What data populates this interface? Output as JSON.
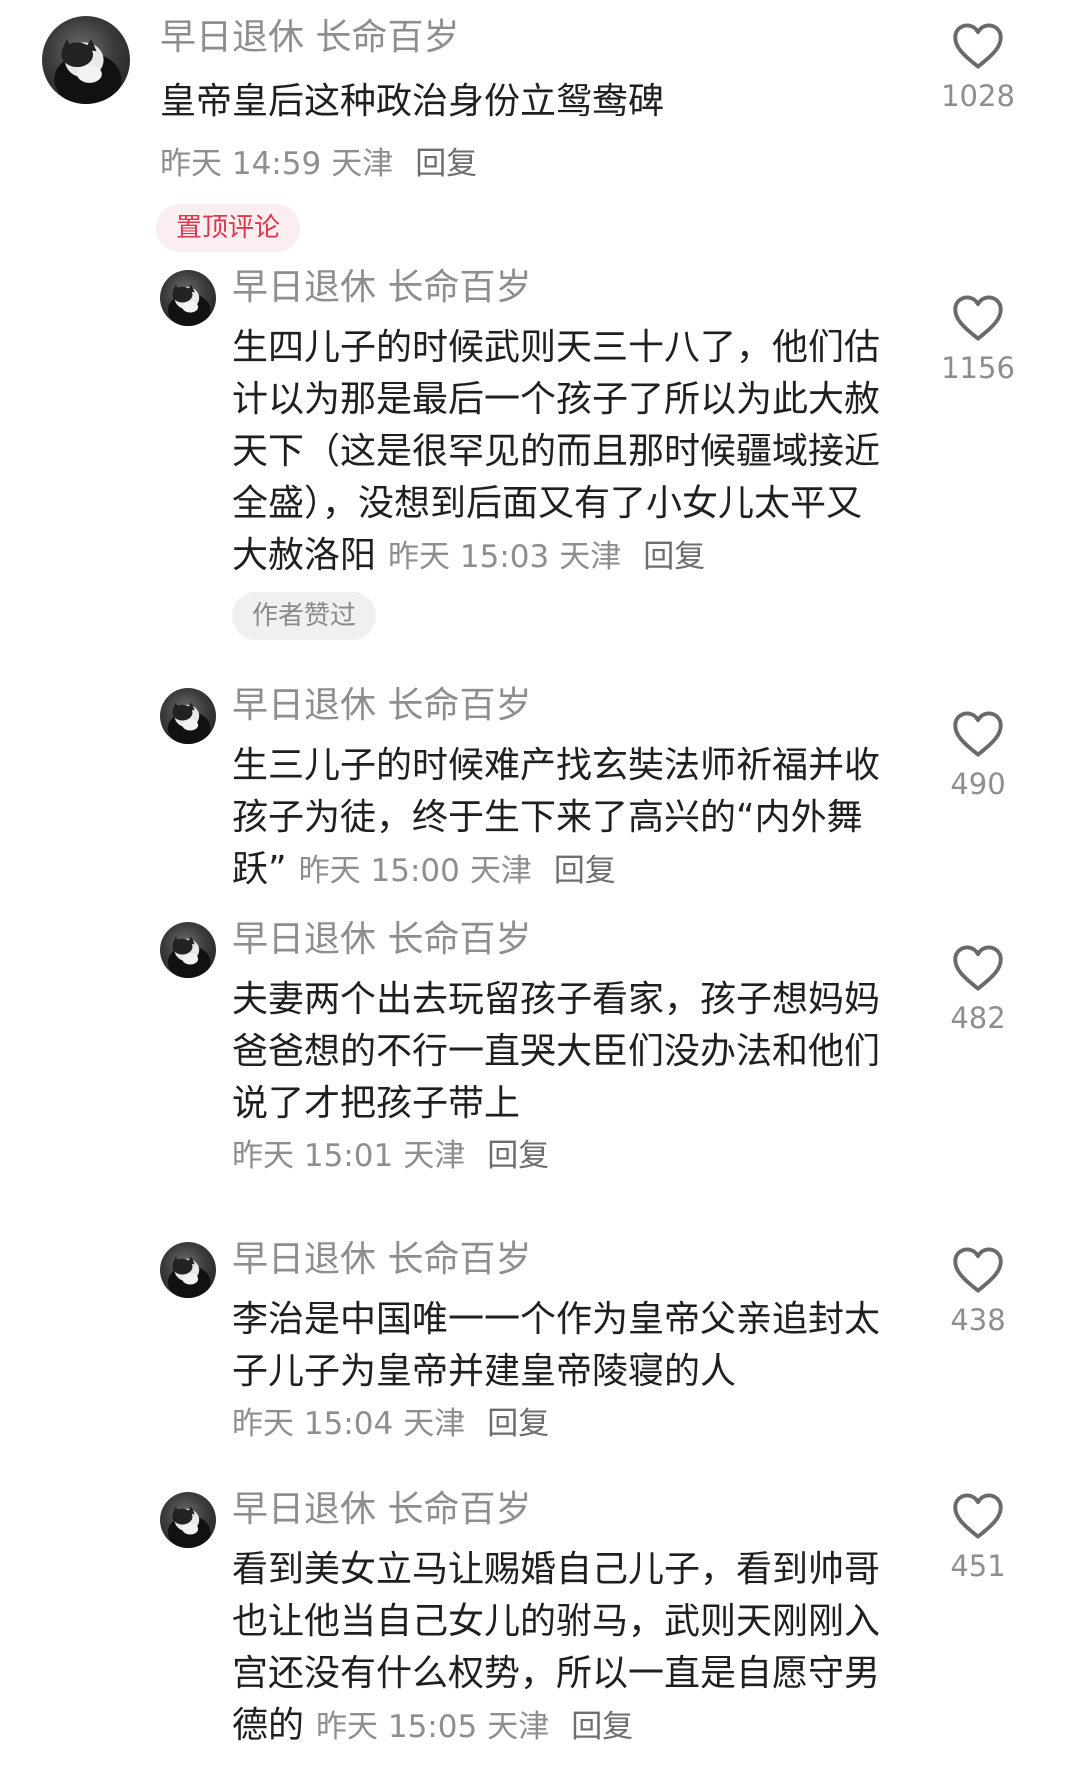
{
  "comments": [
    {
      "username": "早日退休 长命百岁",
      "text": "皇帝皇后这种政治身份立鸳鸯碑",
      "time": "昨天 14:59",
      "location": "天津",
      "reply_label": "回复",
      "likes": "1028",
      "badge": "置顶评论"
    },
    {
      "username": "早日退休 长命百岁",
      "text": "生四儿子的时候武则天三十八了，他们估计以为那是最后一个孩子了所以为此大赦天下（这是很罕见的而且那时候疆域接近全盛），没想到后面又有了小女儿太平又大赦洛阳",
      "time": "昨天 15:03",
      "location": "天津",
      "reply_label": "回复",
      "likes": "1156",
      "badge": "作者赞过"
    },
    {
      "username": "早日退休 长命百岁",
      "text": "生三儿子的时候难产找玄奘法师祈福并收孩子为徒，终于生下来了高兴的“内外舞跃”",
      "time": "昨天 15:00",
      "location": "天津",
      "reply_label": "回复",
      "likes": "490"
    },
    {
      "username": "早日退休 长命百岁",
      "text": "夫妻两个出去玩留孩子看家，孩子想妈妈爸爸想的不行一直哭大臣们没办法和他们说了才把孩子带上",
      "time": "昨天 15:01",
      "location": "天津",
      "reply_label": "回复",
      "likes": "482"
    },
    {
      "username": "早日退休 长命百岁",
      "text": "李治是中国唯一一个作为皇帝父亲追封太子儿子为皇帝并建皇帝陵寝的人",
      "time": "昨天 15:04",
      "location": "天津",
      "reply_label": "回复",
      "likes": "438"
    },
    {
      "username": "早日退休 长命百岁",
      "text": "看到美女立马让赐婚自己儿子，看到帅哥也让他当自己女儿的驸马，武则天刚刚入宫还没有什么权势，所以一直是自愿守男德的",
      "time": "昨天 15:05",
      "location": "天津",
      "reply_label": "回复",
      "likes": "451"
    }
  ],
  "colors": {
    "text": "#1f1f1f",
    "muted": "#8e8e8e",
    "pinned_bg": "#fbeef0",
    "pinned_text": "#d9384f",
    "author_badge_bg": "#f0f0f0"
  },
  "icons": {
    "like": "heart-outline-icon",
    "avatar": "cat-avatar"
  }
}
